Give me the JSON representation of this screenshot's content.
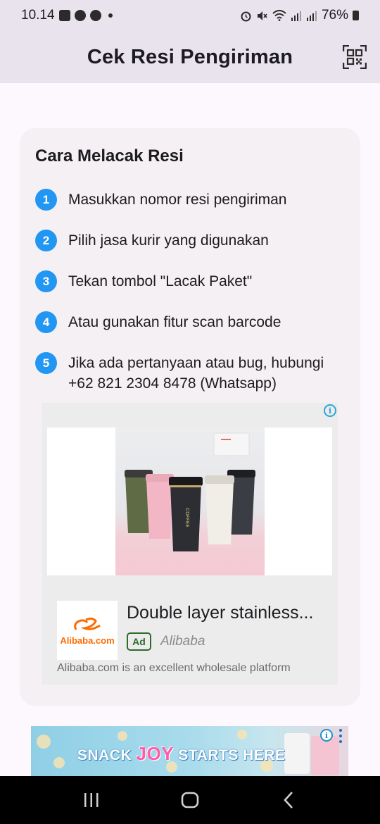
{
  "status_bar": {
    "time": "10.14",
    "battery": "76%"
  },
  "app_bar": {
    "title": "Cek Resi Pengiriman",
    "scan_icon": "qr-scan-icon"
  },
  "guide": {
    "title": "Cara Melacak Resi",
    "steps": [
      {
        "num": "1",
        "text": "Masukkan nomor resi pengiriman"
      },
      {
        "num": "2",
        "text": "Pilih jasa kurir yang digunakan"
      },
      {
        "num": "3",
        "text": "Tekan tombol \"Lacak Paket\""
      },
      {
        "num": "4",
        "text": "Atau gunakan fitur scan barcode"
      },
      {
        "num": "5",
        "text": "Jika ada pertanyaan atau bug, hubungi +62 821 2304 8478 (Whatsapp)"
      }
    ],
    "step_color": "#2196f3"
  },
  "ad": {
    "info_icon": "i",
    "logo_text": "Alibaba.com",
    "headline": "Double layer stainless...",
    "badge": "Ad",
    "source": "Alibaba",
    "description": "Alibaba.com is an excellent wholesale platform",
    "cup_label": "COFFEE"
  },
  "banner": {
    "text_before": "SNACK",
    "text_joy": "JOY",
    "text_after": "STARTS HERE",
    "info_icon": "i"
  },
  "colors": {
    "app_bar_bg": "#e9e3ee",
    "background": "#fdf7fe",
    "card_bg": "#f4f0f4",
    "accent": "#2196f3"
  }
}
